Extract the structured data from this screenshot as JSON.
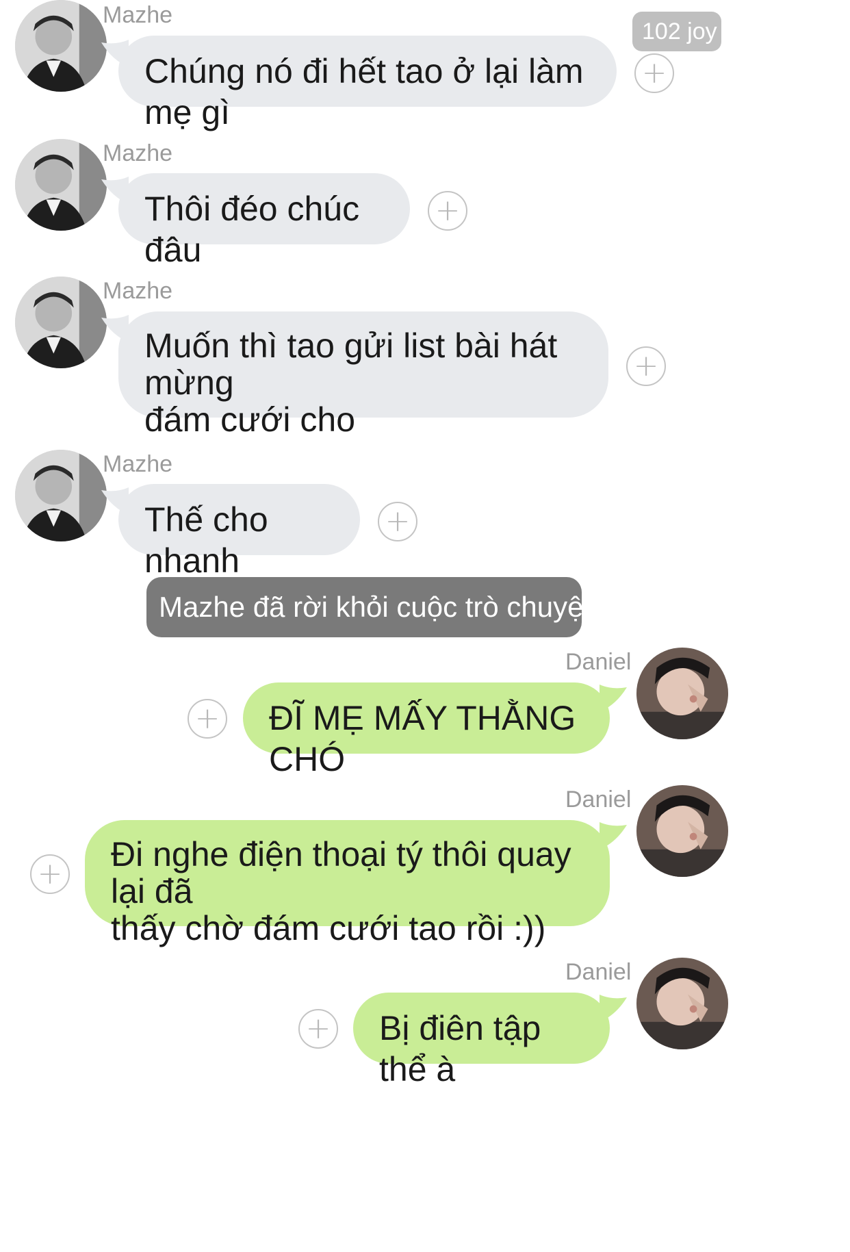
{
  "system": {
    "left_notice": "Mazhe đã rời khỏi cuộc trò chuyện"
  },
  "reaction_badge": {
    "label": "102 joy"
  },
  "colors": {
    "incoming_bubble": "#e8eaed",
    "outgoing_bubble": "#c9ed96",
    "system_pill": "#7a7a7a"
  },
  "messages": [
    {
      "sender": "Mazhe",
      "text": "Chúng nó đi hết tao ở lại làm mẹ gì"
    },
    {
      "sender": "Mazhe",
      "text": "Thôi đéo chúc đâu"
    },
    {
      "sender": "Mazhe",
      "text": "Muốn thì tao gửi list bài hát mừng\nđám cưới cho"
    },
    {
      "sender": "Mazhe",
      "text": "Thế cho nhanh"
    },
    {
      "sender": "Daniel",
      "text": "ĐĨ MẸ MẤY THẰNG CHÓ"
    },
    {
      "sender": "Daniel",
      "text": "Đi nghe điện thoại tý thôi quay lại đã\nthấy chờ đám cưới tao rồi :))"
    },
    {
      "sender": "Daniel",
      "text": "Bị điên tập thể à"
    }
  ]
}
